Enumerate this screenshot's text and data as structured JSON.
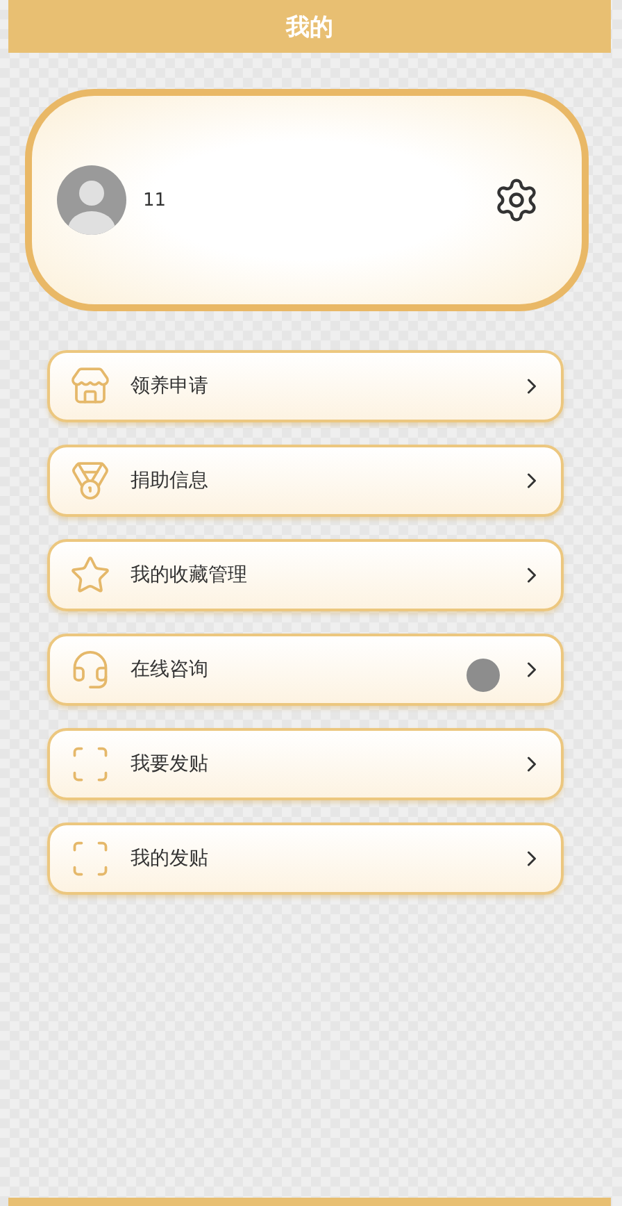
{
  "header": {
    "title": "我的"
  },
  "profile": {
    "name": "11"
  },
  "menu": [
    {
      "label": "领养申请"
    },
    {
      "label": "捐助信息"
    },
    {
      "label": "我的收藏管理"
    },
    {
      "label": "在线咨询"
    },
    {
      "label": "我要发贴"
    },
    {
      "label": "我的发贴"
    }
  ]
}
